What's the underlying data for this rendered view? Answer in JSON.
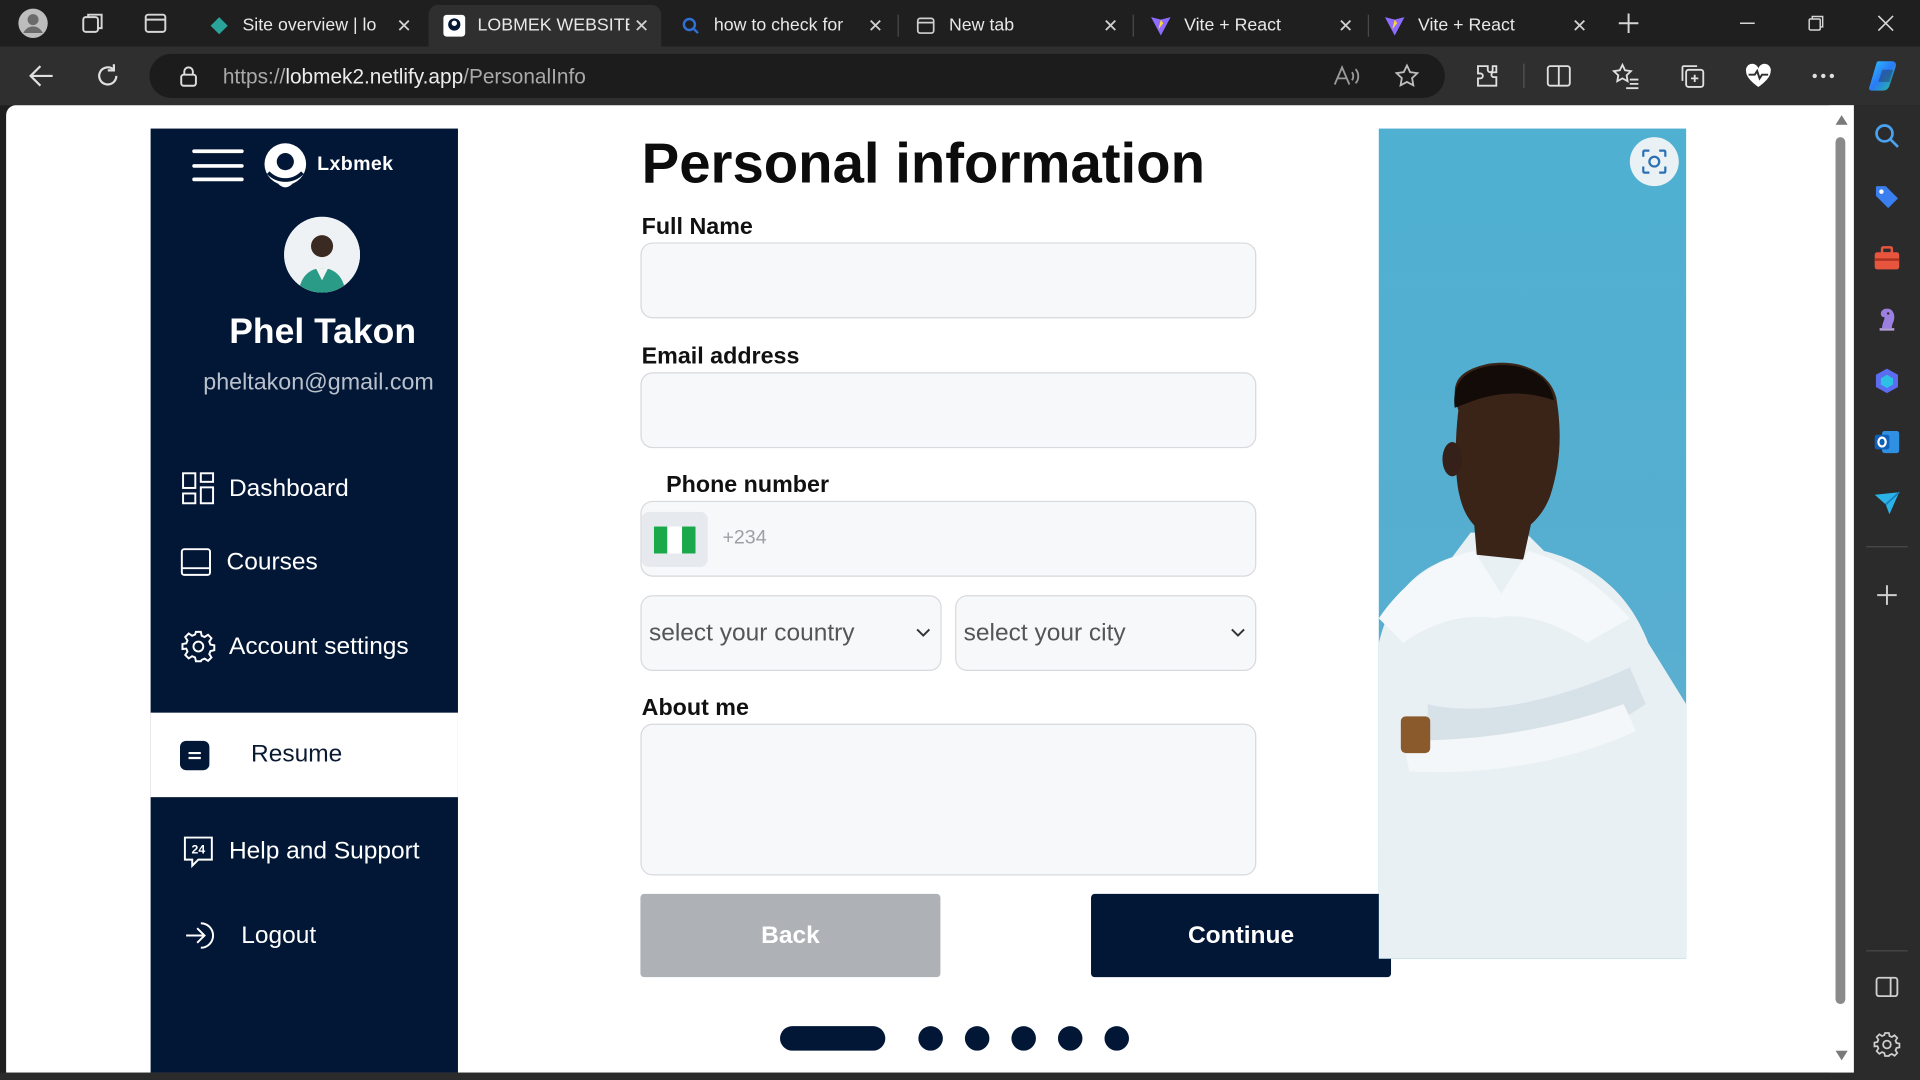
{
  "browser": {
    "tabs": [
      {
        "title": "Site overview | lo",
        "active": false
      },
      {
        "title": "LOBMEK WEBSITE",
        "active": true
      },
      {
        "title": "how to check for",
        "active": false
      },
      {
        "title": "New tab",
        "active": false
      },
      {
        "title": "Vite + React",
        "active": false
      },
      {
        "title": "Vite + React",
        "active": false
      }
    ],
    "url_scheme": "https://",
    "url_host": "lobmek2.netlify.app",
    "url_path": "/PersonalInfo"
  },
  "sidebar": {
    "brand": "Lxbmek",
    "profile_name": "Phel Takon",
    "profile_email": "pheltakon@gmail.com",
    "items": [
      {
        "label": "Dashboard",
        "icon": "dashboard-icon"
      },
      {
        "label": "Courses",
        "icon": "courses-icon"
      },
      {
        "label": "Account settings",
        "icon": "gear-icon"
      },
      {
        "label": "Resume",
        "icon": "resume-icon",
        "active": true
      },
      {
        "label": "Help and Support",
        "icon": "support-24-icon"
      },
      {
        "label": "Logout",
        "icon": "logout-icon"
      }
    ]
  },
  "form": {
    "title": "Personal information",
    "full_name_label": "Full Name",
    "full_name_value": "",
    "email_label": "Email address",
    "email_value": "",
    "phone_label": "Phone number",
    "phone_placeholder": "+234",
    "country_select": "select your country",
    "city_select": "select your city",
    "about_label": "About me",
    "about_value": "",
    "back_label": "Back",
    "continue_label": "Continue"
  },
  "progress": {
    "current_step": 1,
    "total_steps": 6
  },
  "colors": {
    "navy": "#021636",
    "back_button": "#aeb2b7",
    "photo_sky": "#55aed0"
  }
}
